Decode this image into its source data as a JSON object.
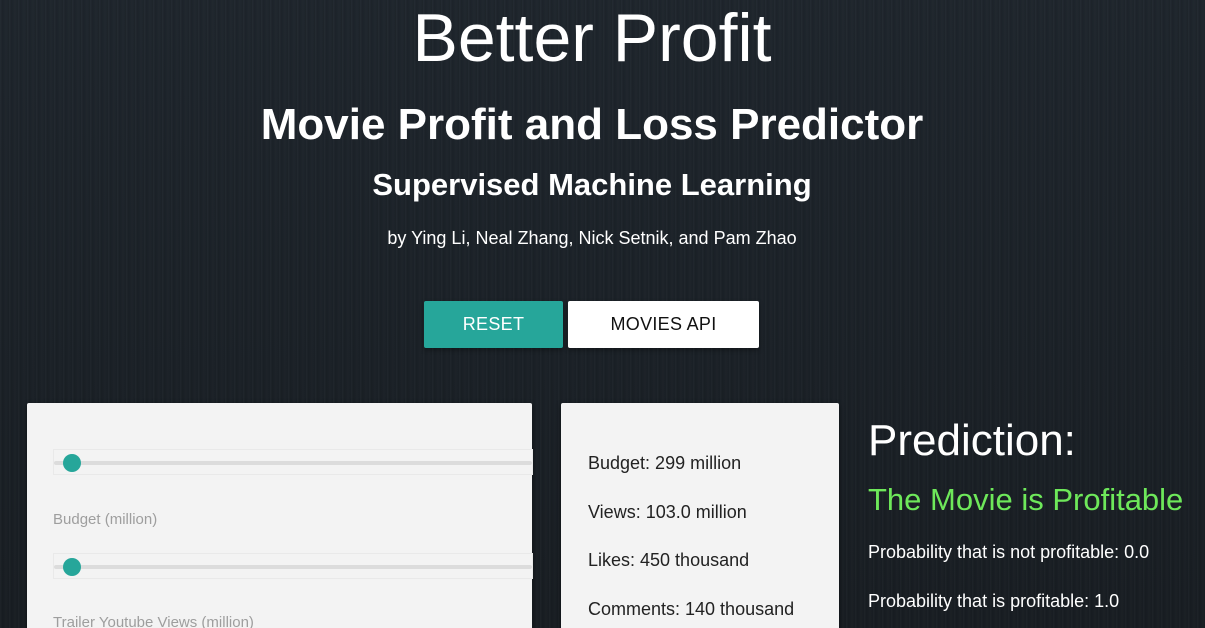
{
  "header": {
    "title": "Better Profit",
    "subtitle": "Movie Profit and Loss Predictor",
    "subsubtitle": "Supervised Machine Learning",
    "authors": "by Ying Li, Neal Zhang, Nick Setnik, and Pam Zhao"
  },
  "buttons": {
    "reset_label": "RESET",
    "api_label": "MOVIES API"
  },
  "sliders": [
    {
      "label": "Budget (million)",
      "value_fraction": 0.0
    },
    {
      "label": "Trailer Youtube Views (million)",
      "value_fraction": 0.0
    }
  ],
  "values": [
    "Budget: 299 million",
    "Views: 103.0 million",
    "Likes: 450 thousand",
    "Comments: 140 thousand"
  ],
  "prediction": {
    "heading": "Prediction:",
    "result": "The Movie is Profitable",
    "prob_not_profitable": "Probability that is not profitable: 0.0",
    "prob_profitable": "Probability that is profitable: 1.0"
  },
  "colors": {
    "accent": "#26a69a",
    "profitable": "#6ee85a",
    "card": "#f3f3f3"
  }
}
